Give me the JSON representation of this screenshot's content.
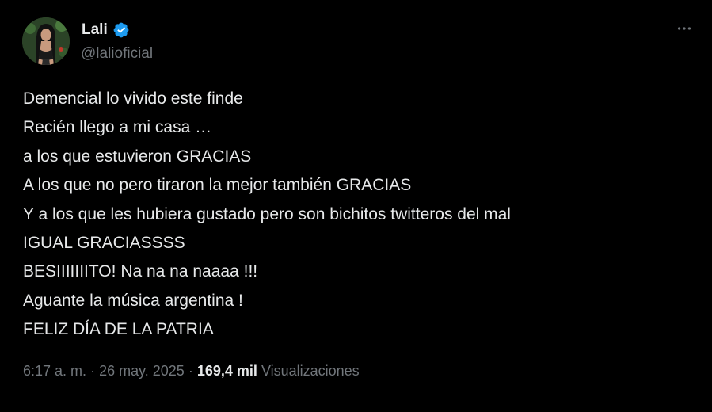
{
  "author": {
    "display_name": "Lali",
    "handle": "@lalioficial",
    "verified": true,
    "avatar_icon": "profile-photo"
  },
  "more_icon": "more-horizontal-icon",
  "tweet": {
    "lines": [
      "Demencial lo vivido este finde",
      "Recién llego a mi casa …",
      "a los que estuvieron GRACIAS",
      "A los que no pero tiraron la mejor también GRACIAS",
      "Y a los que les hubiera gustado pero son bichitos twitteros del mal",
      "IGUAL GRACIASSSS",
      "BESIIIIIIITO! Na na na naaaa !!!",
      "Aguante la música argentina !",
      "FELIZ DÍA DE LA PATRIA"
    ]
  },
  "meta": {
    "time": "6:17 a. m.",
    "separator": "·",
    "date": "26 may. 2025",
    "views_count": "169,4 mil",
    "views_label": "Visualizaciones"
  },
  "colors": {
    "background": "#000000",
    "text_primary": "#e7e9ea",
    "text_secondary": "#71767b",
    "verified_blue": "#1d9bf0",
    "divider": "#2f3336"
  }
}
